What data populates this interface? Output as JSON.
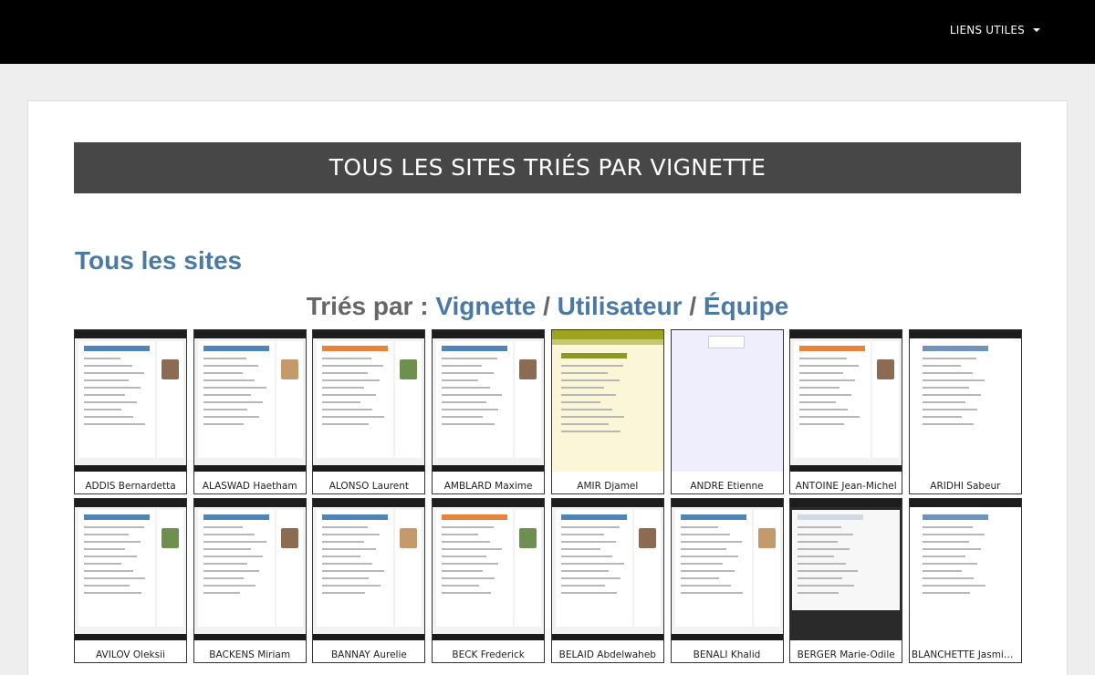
{
  "nav": {
    "menu_label": "LIENS UTILES"
  },
  "banner": {
    "title": "TOUS LES SITES TRIÉS PAR VIGNETTE"
  },
  "section": {
    "title": "Tous les sites"
  },
  "sort": {
    "prefix": "Triés par :",
    "options": [
      "Vignette",
      "Utilisateur",
      "Équipe"
    ],
    "separator": "/"
  },
  "sites": [
    {
      "name": "ADDIS Bernardetta",
      "theme": "blue"
    },
    {
      "name": "ALASWAD Haetham",
      "theme": "blue"
    },
    {
      "name": "ALONSO Laurent",
      "theme": "orange"
    },
    {
      "name": "AMBLARD Maxime",
      "theme": "blue"
    },
    {
      "name": "AMIR Djamel",
      "theme": "cream"
    },
    {
      "name": "ANDRE Etienne",
      "theme": "lavender"
    },
    {
      "name": "ANTOINE Jean-Michel",
      "theme": "orange"
    },
    {
      "name": "ARIDHI Sabeur",
      "theme": "white"
    },
    {
      "name": "AVILOV Oleksii",
      "theme": "blue"
    },
    {
      "name": "BACKENS Miriam",
      "theme": "blue"
    },
    {
      "name": "BANNAY Aurelie",
      "theme": "blue"
    },
    {
      "name": "BECK Frederick",
      "theme": "orange"
    },
    {
      "name": "BELAID Abdelwaheb",
      "theme": "gray"
    },
    {
      "name": "BENALI Khalid",
      "theme": "blue"
    },
    {
      "name": "BERGER Marie-Odile",
      "theme": "dark"
    },
    {
      "name": "BLANCHETTE Jasmin-C...",
      "theme": "white"
    }
  ],
  "colors": {
    "link": "#4a79a5",
    "banner_bg": "#474747",
    "topbar_bg": "#000000"
  }
}
